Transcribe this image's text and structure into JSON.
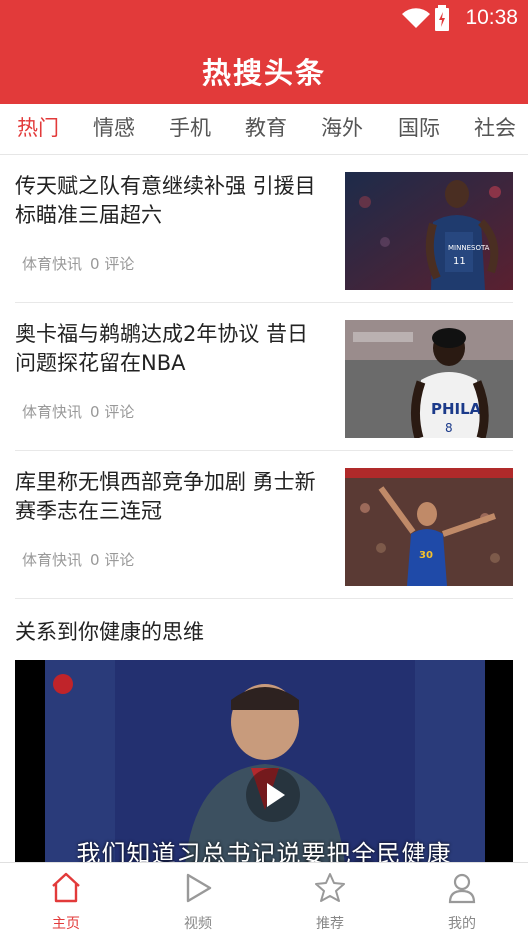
{
  "status": {
    "time": "10:38"
  },
  "header": {
    "title": "热搜头条"
  },
  "tabs": [
    "热门",
    "情感",
    "手机",
    "教育",
    "海外",
    "国际",
    "社会"
  ],
  "news": [
    {
      "headline": "传天赋之队有意继续补强 引援目标瞄准三届超六",
      "source": "体育快讯",
      "comments": "0 评论"
    },
    {
      "headline": "奥卡福与鹈鹕达成2年协议 昔日问题探花留在NBA",
      "source": "体育快讯",
      "comments": "0 评论"
    },
    {
      "headline": "库里称无惧西部竞争加剧 勇士新赛季志在三连冠",
      "source": "体育快讯",
      "comments": "0 评论"
    }
  ],
  "video": {
    "title": "关系到你健康的思维",
    "subtitle": "我们知道习总书记说要把全民健康"
  },
  "bottom_nav": [
    {
      "label": "主页",
      "icon": "home-icon"
    },
    {
      "label": "视频",
      "icon": "play-icon"
    },
    {
      "label": "推荐",
      "icon": "star-icon"
    },
    {
      "label": "我的",
      "icon": "user-icon"
    }
  ],
  "colors": {
    "brand": "#e23a3a",
    "text": "#222222",
    "meta": "#999999"
  }
}
